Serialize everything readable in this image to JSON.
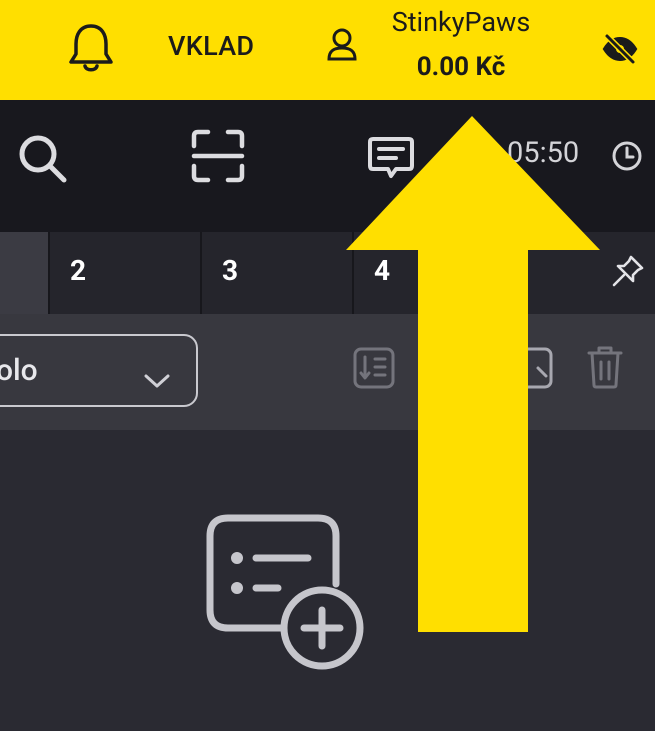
{
  "header": {
    "deposit_label": "VKLAD",
    "username": "StinkyPaws",
    "balance": "0.00 Kč",
    "icons": [
      "bell-icon",
      "user-icon",
      "eye-off-icon"
    ]
  },
  "toolbar": {
    "time": "05:50",
    "icons": [
      "search-icon",
      "scan-icon",
      "chat-icon",
      "clock-icon"
    ]
  },
  "tabs": [
    {
      "label": ""
    },
    {
      "label": "2"
    },
    {
      "label": "3"
    },
    {
      "label": "4"
    }
  ],
  "filter": {
    "select_value": "olo"
  },
  "colors": {
    "brand_yellow": "#ffdf00",
    "toolbar_bg": "#18181e",
    "panel_bg": "#2a2a32"
  }
}
